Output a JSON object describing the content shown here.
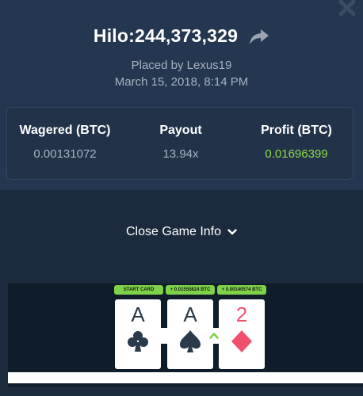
{
  "bet": {
    "title": "Hilo:244,373,329",
    "placed_by": "Placed by Lexus19",
    "date": "March 15, 2018, 8:14 PM"
  },
  "stats": [
    {
      "label": "Wagered (BTC)",
      "value": "0.00131072"
    },
    {
      "label": "Payout",
      "value": "13.94x"
    },
    {
      "label": "Profit (BTC)",
      "value": "0.01696399"
    }
  ],
  "toggle_label": "Close Game Info",
  "cards": [
    {
      "badge": "START CARD",
      "rank": "A",
      "suit": "club-icon",
      "color": "#2a3a4a"
    },
    {
      "badge": "+ 0.01555824 BTC",
      "rank": "A",
      "suit": "spade-icon",
      "color": "#2a3a4a"
    },
    {
      "badge": "+ 0.00140574 BTC",
      "rank": "2",
      "suit": "diamond-icon",
      "color": "#f1506c"
    }
  ],
  "colors": {
    "background": "#1b2a3d",
    "header": "#243650",
    "profit_green": "#8fd84c",
    "badge_green": "#7fd14a",
    "red_card": "#f1506c"
  }
}
